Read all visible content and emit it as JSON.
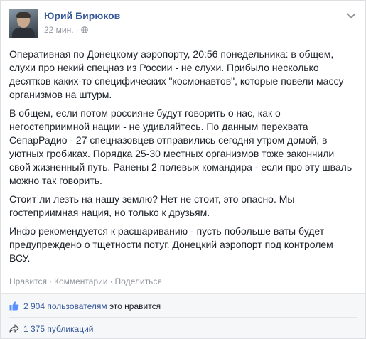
{
  "post": {
    "author": "Юрий Бирюков",
    "time": "22 мин.",
    "meta_dot": "·",
    "paragraphs": [
      "Оперативная по Донецкому аэропорту, 20:56 понедельника: в общем, слухи про некий спецназ из России - не слухи. Прибыло несколько десятков каких-то специфических \"космонавтов\", которые повели массу организмов на штурм.",
      "В общем, если потом россияне будут говорить о нас, как о негостеприимной нации - не удивляйтесь. По данным перехвата СепарРадио - 27 спецназовцев отправились сегодня утром домой, в уютных гробиках. Порядка 25-30 местных организмов тоже закончили свой жизненный путь. Ранены 2 полевых командира - если про эту шваль можно так говорить.",
      "Стоит ли лезть на нашу землю? Нет не стоит, это опасно. Мы гостеприимная нация, но только к друзьям.",
      "Инфо рекомендуется к расшариванию - пусть побольше ваты будет предупреждено о тщетности потуг. Донецкий аэропорт под контролем ВСУ."
    ]
  },
  "actions": {
    "like": "Нравится",
    "comment": "Комментарии",
    "share": "Поделиться",
    "separator": "·"
  },
  "stats": {
    "likes_link": "2 904 пользователям",
    "likes_suffix": " это нравится",
    "shares": "1 375 публикаций"
  },
  "colors": {
    "link": "#365899",
    "meta": "#90949c",
    "text": "#1d2129"
  },
  "icons": {
    "privacy": "globe-icon",
    "options": "chevron-down-icon",
    "like": "thumbs-up-icon",
    "share": "share-arrow-icon"
  }
}
